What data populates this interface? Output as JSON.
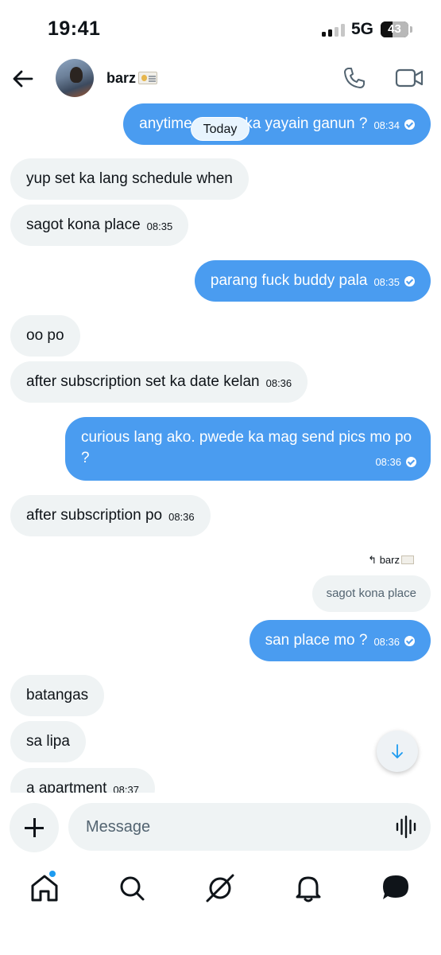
{
  "status_bar": {
    "time": "19:41",
    "network": "5G",
    "battery": "43",
    "battery_level": 0.43
  },
  "header": {
    "contact_name": "barz",
    "badge_icon": "id-card-icon"
  },
  "today_label": "Today",
  "messages": [
    {
      "side": "out",
      "text": "anytime pwede ka yayain ganun ?",
      "time": "08:34"
    },
    {
      "side": "in",
      "text": "yup set ka lang schedule when",
      "time": ""
    },
    {
      "side": "in",
      "text": "sagot kona place",
      "time": "08:35"
    },
    {
      "side": "out",
      "text": "parang fuck buddy pala",
      "time": "08:35"
    },
    {
      "side": "in",
      "text": "oo po",
      "time": ""
    },
    {
      "side": "in",
      "text": "after subscription set ka date kelan",
      "time": "08:36"
    },
    {
      "side": "out",
      "text": "curious lang ako. pwede ka mag send pics mo po ?",
      "time": "08:36"
    },
    {
      "side": "in",
      "text": "after subscription po",
      "time": "08:36"
    },
    {
      "side": "out",
      "text": "san place mo ?",
      "time": "08:36"
    },
    {
      "side": "in",
      "text": "batangas",
      "time": ""
    },
    {
      "side": "in",
      "text": "sa lipa",
      "time": ""
    },
    {
      "side": "in",
      "text": "a apartment",
      "time": "08:37"
    }
  ],
  "reply": {
    "label": "barz",
    "quoted_text": "sagot kona place"
  },
  "composer": {
    "placeholder": "Message"
  },
  "nav": [
    "home-icon",
    "search-icon",
    "grok-icon",
    "notifications-icon",
    "messages-icon"
  ],
  "colors": {
    "outgoing_bubble": "#4a9cf0",
    "incoming_bubble": "#eff3f4",
    "accent": "#1d9bf0"
  }
}
